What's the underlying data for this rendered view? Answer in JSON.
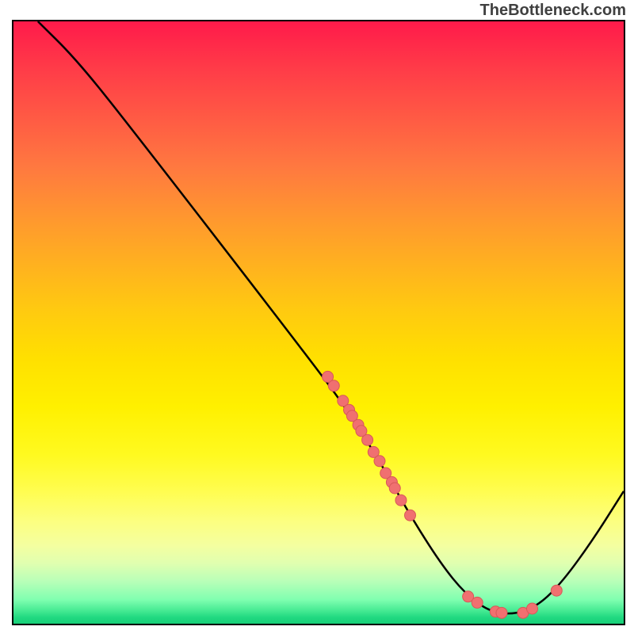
{
  "watermark": "TheBottleneck.com",
  "chart_data": {
    "type": "line",
    "title": "",
    "xlabel": "",
    "ylabel": "",
    "xlim": [
      0,
      100
    ],
    "ylim": [
      0,
      100
    ],
    "curve": [
      {
        "x": 4,
        "y": 100
      },
      {
        "x": 10,
        "y": 94
      },
      {
        "x": 18,
        "y": 84
      },
      {
        "x": 50,
        "y": 42
      },
      {
        "x": 55,
        "y": 35
      },
      {
        "x": 60,
        "y": 27
      },
      {
        "x": 65,
        "y": 18
      },
      {
        "x": 70,
        "y": 10
      },
      {
        "x": 74,
        "y": 5
      },
      {
        "x": 78,
        "y": 2
      },
      {
        "x": 82,
        "y": 1.5
      },
      {
        "x": 86,
        "y": 3
      },
      {
        "x": 90,
        "y": 7
      },
      {
        "x": 95,
        "y": 14
      },
      {
        "x": 100,
        "y": 22
      }
    ],
    "scatter_points": [
      {
        "x": 51.5,
        "y": 41
      },
      {
        "x": 52.5,
        "y": 39.5
      },
      {
        "x": 54,
        "y": 37
      },
      {
        "x": 55,
        "y": 35.5
      },
      {
        "x": 55.5,
        "y": 34.5
      },
      {
        "x": 56.5,
        "y": 33
      },
      {
        "x": 57,
        "y": 32
      },
      {
        "x": 58,
        "y": 30.5
      },
      {
        "x": 59,
        "y": 28.5
      },
      {
        "x": 60,
        "y": 27
      },
      {
        "x": 61,
        "y": 25
      },
      {
        "x": 62,
        "y": 23.5
      },
      {
        "x": 62.5,
        "y": 22.5
      },
      {
        "x": 63.5,
        "y": 20.5
      },
      {
        "x": 65,
        "y": 18
      },
      {
        "x": 74.5,
        "y": 4.5
      },
      {
        "x": 76,
        "y": 3.5
      },
      {
        "x": 79,
        "y": 2
      },
      {
        "x": 80,
        "y": 1.8
      },
      {
        "x": 83.5,
        "y": 1.8
      },
      {
        "x": 85,
        "y": 2.5
      },
      {
        "x": 89,
        "y": 5.5
      }
    ],
    "colors": {
      "curve": "#000000",
      "points_fill": "#f07070",
      "points_stroke": "#d85858"
    }
  }
}
